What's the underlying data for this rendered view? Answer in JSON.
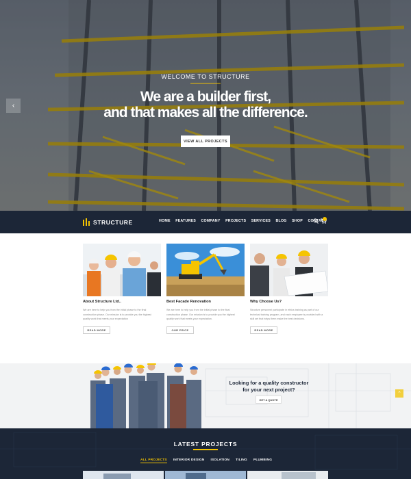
{
  "hero": {
    "kicker": "WELCOME TO STRUCTURE",
    "title_line1": "We are a builder first,",
    "title_line2": "and that makes all the difference.",
    "button": "VIEW ALL PROJECTS"
  },
  "nav": {
    "logo": "STRUCTURE",
    "items": [
      "HOME",
      "FEATURES",
      "COMPANY",
      "PROJECTS",
      "SERVICES",
      "BLOG",
      "SHOP",
      "CONTACT"
    ],
    "icons": [
      "search-icon",
      "cart-icon"
    ]
  },
  "features": [
    {
      "title": "About Structure Ltd..",
      "text": "We are here to help you from the initial phase to the final construction phase. Our mission is to provide you the highest quality work that meets your expectation",
      "button": "READ MORE"
    },
    {
      "title": "Best Facade Renovation",
      "text": "We are here to help you from the initial phase to the final construction phase. Our mission is to provide you the highest quality work that meets your expectation.",
      "button": "OUR PRICE"
    },
    {
      "title": "Why Choose Us?",
      "text": "Structure personnel participate in ethics training as part of our technical training program, and each employee is provided with a skill set that helps them make the best decisions.",
      "button": "READ MORE"
    }
  ],
  "cta": {
    "title_line1": "Looking for a quality constructor",
    "title_line2": "for your next project?",
    "button": "GET A QUOTE"
  },
  "projects": {
    "title": "LATEST PROJECTS",
    "filters": [
      "ALL PROJECTS",
      "INTERIOR DESIGN",
      "ISOLATION",
      "TILING",
      "PLUMBING"
    ],
    "active_filter": "ALL PROJECTS"
  },
  "colors": {
    "accent": "#f3c300",
    "navy": "#1c2637"
  }
}
